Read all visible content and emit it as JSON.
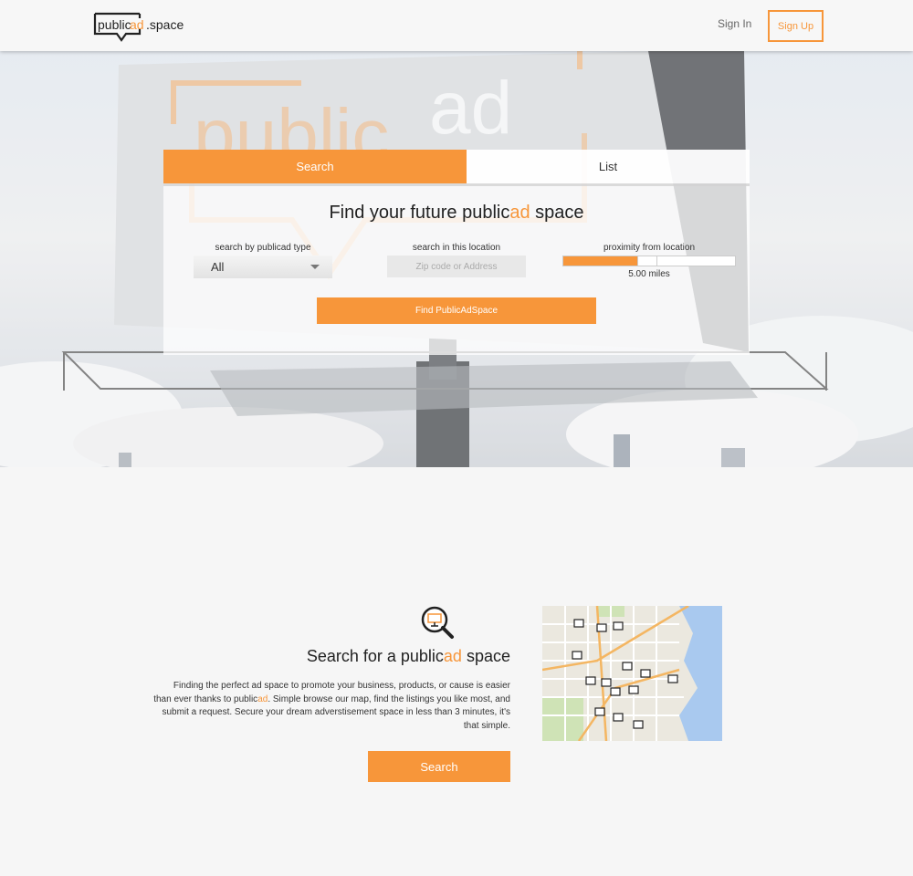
{
  "header": {
    "logo_text_left": "public",
    "logo_text_accent": "ad",
    "logo_text_right": ".space",
    "sign_in": "Sign In",
    "sign_up": "Sign Up"
  },
  "hero": {
    "billboard_text_left": "public",
    "billboard_text_right": "ad"
  },
  "search_panel": {
    "tabs": [
      {
        "label": "Search",
        "active": true
      },
      {
        "label": "List",
        "active": false
      }
    ],
    "title_before": "Find your future public",
    "title_accent": "ad",
    "title_after": " space",
    "type_label": "search by publicad type",
    "type_value": "All",
    "location_label": "search in this location",
    "location_placeholder": "Zip code or Address",
    "proximity_label": "proximity from location",
    "proximity_value": "5.00 miles",
    "proximity_fraction": 0.43,
    "find_button": "Find PublicAdSpace"
  },
  "feature": {
    "title_before": "Search for a public",
    "title_accent": "ad",
    "title_after": " space",
    "desc_1": "Finding the perfect ad space to promote your business, products, or cause is easier than ever thanks to public",
    "desc_accent": "ad",
    "desc_2": ". Simple browse our map, find the listings you like most, and submit a request. Secure your dream adverstisement space in less than 3 minutes, it's that simple.",
    "button": "Search"
  },
  "colors": {
    "accent": "#f7963a",
    "background": "#f6f6f6"
  }
}
